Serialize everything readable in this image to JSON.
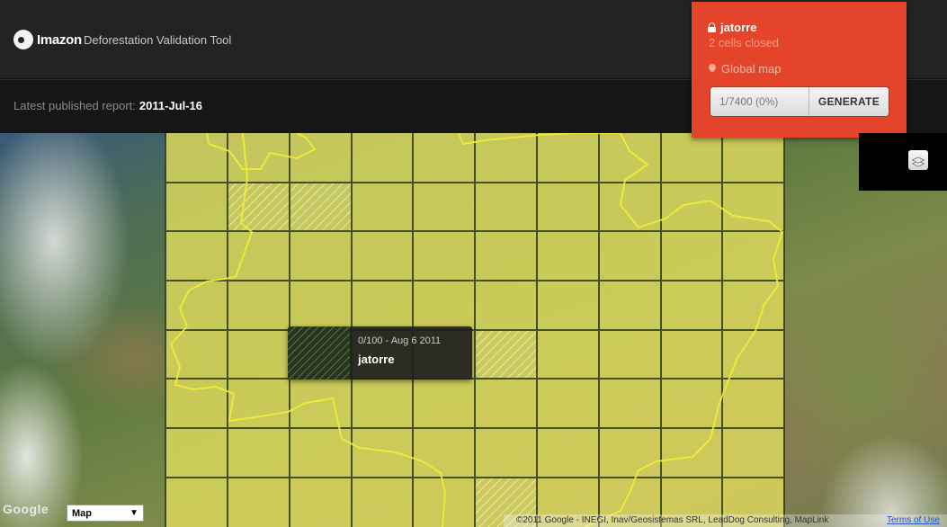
{
  "header": {
    "logo_text": "Imazon",
    "app_title": "Deforestation Validation Tool"
  },
  "report": {
    "label": "Latest published report:",
    "date": "2011-Jul-16"
  },
  "user_panel": {
    "username": "jatorre",
    "cells_closed": "2 cells closed",
    "map_label": "Global map",
    "progress_text": "1/7400 (0%)",
    "generate_label": "GENERATE",
    "background_color": "#e4452a"
  },
  "tooltip": {
    "meta": "0/100 - Aug 6 2011",
    "user": "jatorre"
  },
  "map_controls": {
    "map_type_selected": "Map",
    "map_type_arrow": "▼",
    "google_logo": "Google",
    "layers_icon": "layers-icon"
  },
  "footer": {
    "attribution": "©2011 Google - INEGI, Inav/Geosistemas SRL, LeadDog Consulting, MapLink",
    "terms_label": "Terms of Use"
  },
  "colors": {
    "overlay": "#d8d65c",
    "grid_line": "#2e3a1e",
    "border_line": "#f2ec3a"
  }
}
